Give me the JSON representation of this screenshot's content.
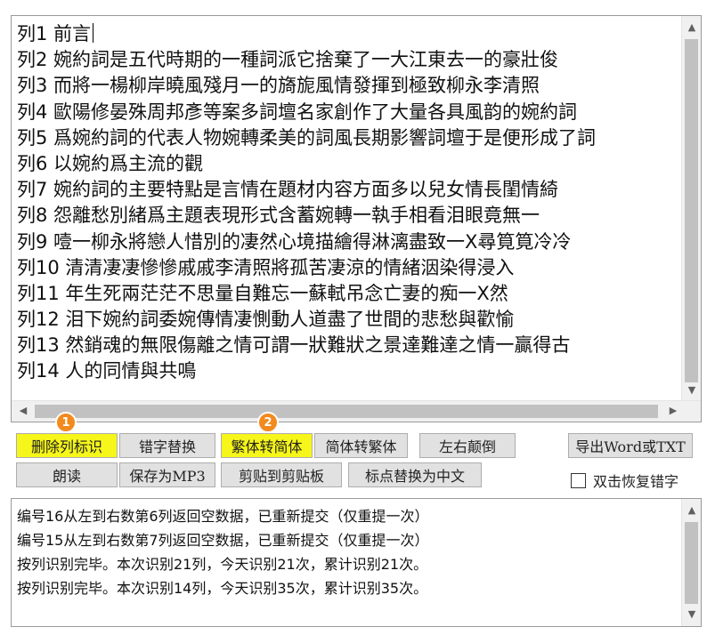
{
  "editor": {
    "lines": [
      "列1 前言",
      "列2 婉約詞是五代時期的一種詞派它捨棄了一大江東去一的豪壯俊",
      "列3 而將一楊柳岸曉風殘月一的旖旎風情發揮到極致柳永李清照",
      "列4 歐陽修晏殊周邦彥等案多詞壇名家創作了大量各具風韵的婉約詞",
      "列5 爲婉約詞的代表人物婉轉柔美的詞風長期影響詞壇于是便形成了詞",
      "列6 以婉約爲主流的觀",
      "列7 婉約詞的主要特點是言情在題材内容方面多以兒女情長閨情綺",
      "列8 怨離愁別緒爲主題表現形式含蓄婉轉一執手相看泪眼竟無一",
      "列9 噎一柳永將戀人惜別的凄然心境描繪得淋漓盡致一X尋筧筧冷冷",
      "列10 清清凄凄慘慘戚戚李清照將孤苦凄涼的情緒洇染得浸入",
      "列11 年生死兩茫茫不思量自難忘一蘇軾吊念亡妻的痴一X然",
      "列12 泪下婉約詞委婉傳情凄惻動人道盡了世間的悲愁與歡愉",
      "列13 然銷魂的無限傷離之情可謂一狀難狀之景達難達之情一贏得古",
      "列14 人的同情與共鳴"
    ]
  },
  "buttons": {
    "delete_column_mark": "删除列标识",
    "typo_replace": "错字替换",
    "trad_to_simp": "繁体转简体",
    "simp_to_trad": "简体转繁体",
    "reverse_lr": "左右颠倒",
    "export": "导出Word或TXT",
    "read_aloud": "朗读",
    "save_mp3": "保存为MP3",
    "cut_clipboard": "剪贴到剪贴板",
    "punct_replace": "标点替换为中文"
  },
  "badges": {
    "one": "1",
    "two": "2"
  },
  "checkbox": {
    "label": "双击恢复错字",
    "checked": false
  },
  "log": {
    "lines": [
      "编号16从左到右数第6列返回空数据，已重新提交（仅重提一次）",
      "编号15从左到右数第7列返回空数据，已重新提交（仅重提一次）",
      "按列识别完毕。本次识别21列，今天识别21次，累计识别21次。",
      "按列识别完毕。本次识别14列，今天识别35次，累计识别35次。"
    ]
  },
  "icons": {
    "up": "▲",
    "down": "▼",
    "left": "◀",
    "right": "▶"
  },
  "colors": {
    "highlight": "#f6f61a",
    "badge": "#f28a1e",
    "button": "#e1e1e1"
  }
}
